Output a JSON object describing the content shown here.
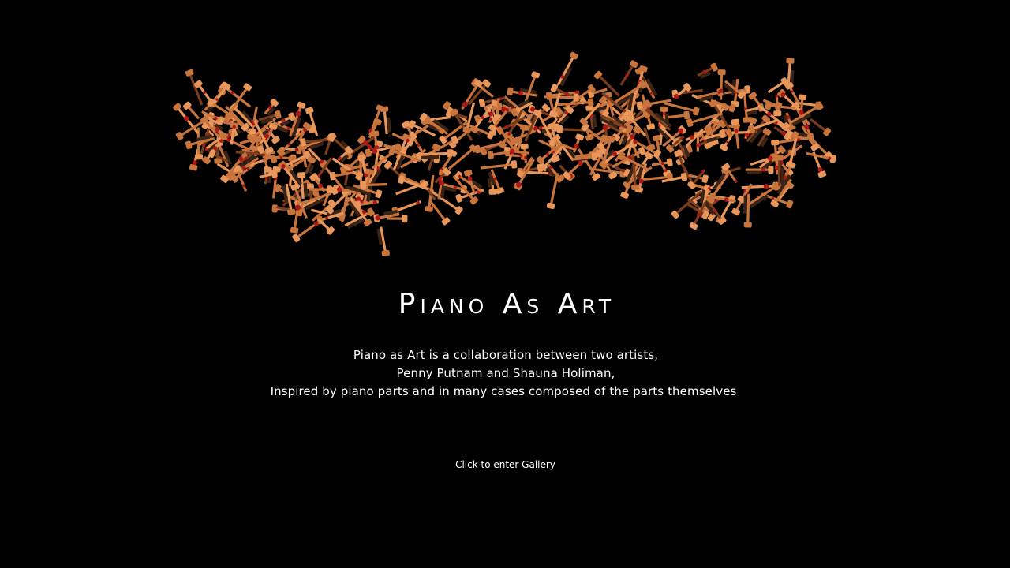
{
  "hero": {
    "image_alt": "Sculpture of interlocking piano hammers",
    "colors": {
      "wood": "#c8743c",
      "wood_light": "#e8965a",
      "wood_dark": "#7a3d1c",
      "felt_red": "#b01818",
      "background": "#000000"
    }
  },
  "title": "Piano As Art",
  "description": {
    "line1": "Piano as Art is a collaboration  between two artists,",
    "line2": "Penny Putnam and Shauna Holiman,",
    "line3": "Inspired by piano parts and in many cases composed of the parts themselves"
  },
  "gallery_link": {
    "label": "Click to enter Gallery"
  }
}
